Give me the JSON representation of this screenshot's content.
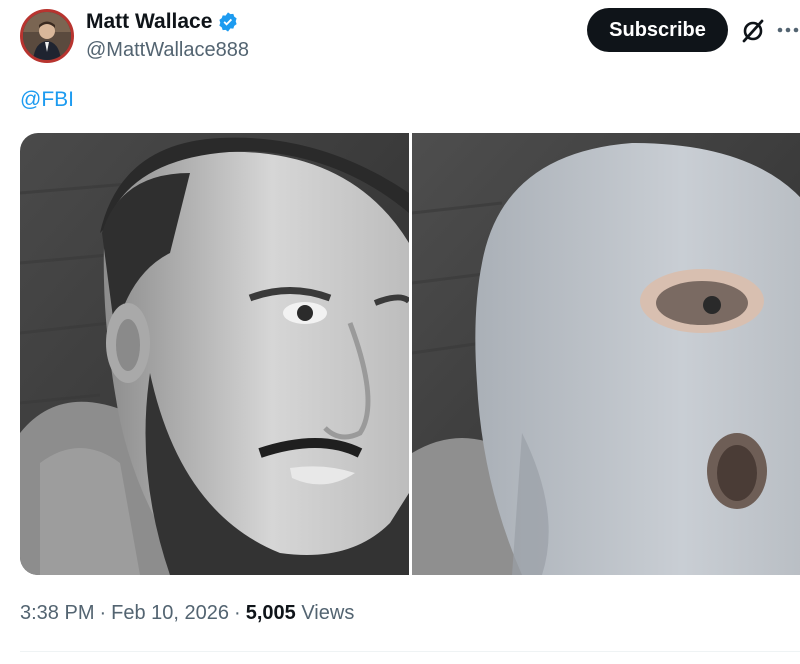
{
  "author": {
    "name": "Matt Wallace",
    "handle": "@MattWallace888",
    "verified": true,
    "badge_color": "#1d9bf0",
    "avatar_ring_color": "#b8342f"
  },
  "actions": {
    "subscribe_label": "Subscribe",
    "grok_icon": "grok-icon",
    "more_icon": "more-icon"
  },
  "tweet": {
    "text": "@FBI"
  },
  "media": [
    {
      "description": "Photo of a bearded man"
    },
    {
      "description": "Photo of a person wearing a light gray balaclava"
    }
  ],
  "meta": {
    "time": "3:38 PM",
    "separator": "·",
    "date": "Feb 10, 2026",
    "views_count": "5,005",
    "views_label": "Views"
  },
  "colors": {
    "link": "#1d9bf0",
    "text_primary": "#0f1419",
    "text_secondary": "#536471",
    "button_bg": "#0f1419"
  }
}
